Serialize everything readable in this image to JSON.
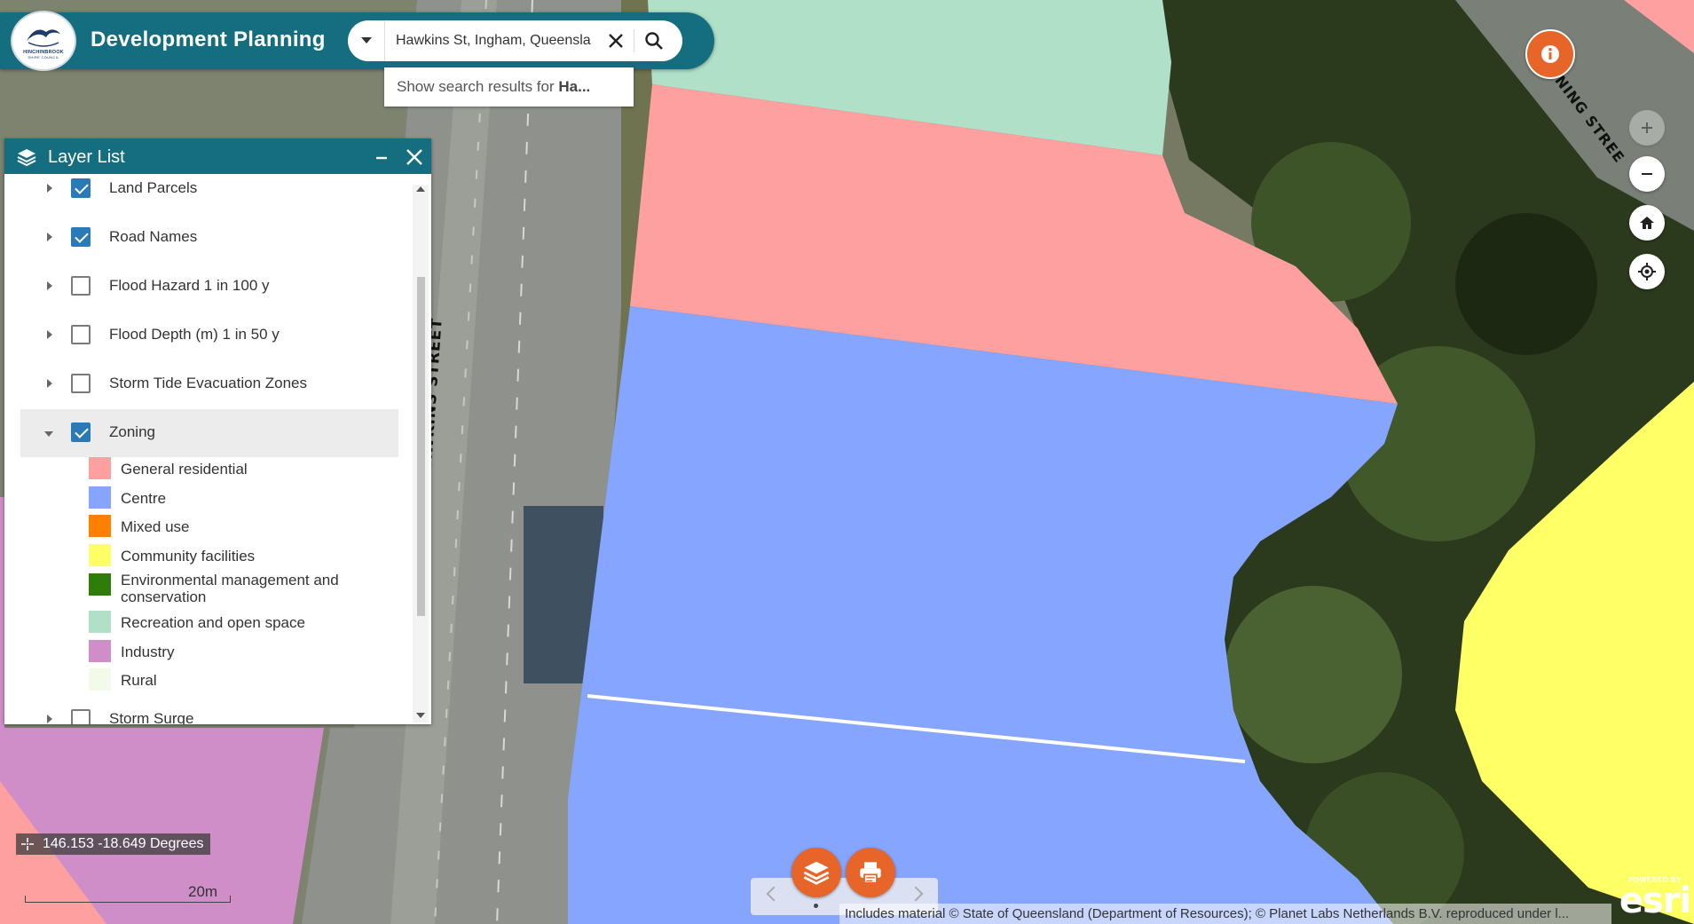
{
  "header": {
    "app_title": "Development Planning",
    "logo": {
      "name": "council-logo",
      "line1": "HINCHINBROOK",
      "line2": "SHIRE COUNCIL"
    }
  },
  "search": {
    "value": "Hawkins St, Ingham, Queensla",
    "scope_icon": "caret-down-icon",
    "clear_icon": "close-icon",
    "search_icon": "search-icon",
    "suggestion_prefix": "Show search results for ",
    "suggestion_term": "Ha..."
  },
  "layer_list": {
    "title": "Layer List",
    "layers": [
      {
        "label": "Land Parcels",
        "checked": true
      },
      {
        "label": "Road Names",
        "checked": true
      },
      {
        "label": "Flood Hazard 1 in 100 y",
        "checked": false
      },
      {
        "label": "Flood Depth (m) 1 in 50 y",
        "checked": false
      },
      {
        "label": "Storm Tide Evacuation Zones",
        "checked": false
      },
      {
        "label": "Zoning",
        "checked": true,
        "expanded": true
      },
      {
        "label": "Storm Surge",
        "checked": false
      }
    ],
    "zoning_legend": [
      {
        "label": "General residential",
        "color": "#ffa0a0"
      },
      {
        "label": "Centre",
        "color": "#85a5ff"
      },
      {
        "label": "Mixed use",
        "color": "#ff8000"
      },
      {
        "label": "Community facilities",
        "color": "#ffff66"
      },
      {
        "label": "Environmental management and conservation",
        "color": "#2e7d0a"
      },
      {
        "label": "Recreation and open space",
        "color": "#b0e0c8"
      },
      {
        "label": "Industry",
        "color": "#d08ec8"
      },
      {
        "label": "Rural",
        "color": "#f3fbe8"
      }
    ]
  },
  "map": {
    "street_labels": [
      "HAWKINS STREET",
      "NNING STREE"
    ],
    "coordinates": "146.153 -18.649 Degrees",
    "scale": "20m",
    "attribution": "Includes material © State of Queensland (Department of Resources); © Planet Labs Netherlands B.V. reproduced under l...",
    "powered_by": "POWERED BY",
    "esri": "esri"
  },
  "controls": {
    "info_icon": "info-icon",
    "zoom_in_icon": "plus-icon",
    "zoom_out_icon": "minus-icon",
    "home_icon": "home-icon",
    "locate_icon": "locate-icon"
  },
  "dock": {
    "layers_icon": "layers-icon",
    "print_icon": "print-icon"
  },
  "colors": {
    "header": "#146e80",
    "accent": "#e8652a",
    "general_residential": "#ffa0a0",
    "centre": "#85a5ff",
    "recreation": "#b0e0c8",
    "community": "#ffff66",
    "industry": "#d08ec8"
  }
}
